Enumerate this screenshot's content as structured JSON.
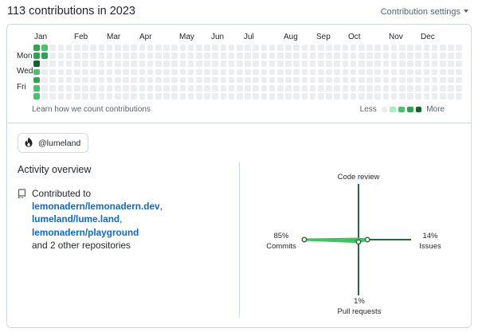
{
  "header": {
    "title": "113 contributions in 2023",
    "settings_label": "Contribution settings"
  },
  "calendar": {
    "months": [
      "Jan",
      "Feb",
      "Mar",
      "Apr",
      "May",
      "Jun",
      "Jul",
      "Aug",
      "Sep",
      "Oct",
      "Nov",
      "Dec"
    ],
    "day_labels": [
      "Mon",
      "Wed",
      "Fri"
    ],
    "weeks": 53,
    "active_cells": [
      {
        "week": 0,
        "day": 0,
        "level": 3
      },
      {
        "week": 0,
        "day": 1,
        "level": 3
      },
      {
        "week": 0,
        "day": 2,
        "level": 4
      },
      {
        "week": 0,
        "day": 3,
        "level": 2
      },
      {
        "week": 0,
        "day": 4,
        "level": 3
      },
      {
        "week": 0,
        "day": 5,
        "level": 2
      },
      {
        "week": 0,
        "day": 6,
        "level": 2
      },
      {
        "week": 1,
        "day": 0,
        "level": 2
      },
      {
        "week": 1,
        "day": 1,
        "level": 3
      }
    ],
    "footer_link": "Learn how we count contributions",
    "legend_less": "Less",
    "legend_more": "More",
    "colors": [
      "#ebedf0",
      "#aceebb",
      "#4ac26b",
      "#2da44e",
      "#116329"
    ]
  },
  "organization": {
    "name": "@lumeland",
    "icon": "lume-fire-icon"
  },
  "activity": {
    "title": "Activity overview",
    "contributed_prefix": "Contributed to",
    "repos": [
      "lemonadern/lemonadern.dev",
      "lumeland/lume.land",
      "lemonadern/playground"
    ],
    "suffix": "and 2 other repositories",
    "repo_icon": "repo-icon"
  },
  "radar": {
    "code_review": {
      "label": "Code review",
      "percent": ""
    },
    "commits": {
      "label": "Commits",
      "percent": "85%",
      "value": 85
    },
    "issues": {
      "label": "Issues",
      "percent": "14%",
      "value": 14
    },
    "pull_requests": {
      "label": "Pull requests",
      "percent": "1%",
      "value": 1
    },
    "axis_color": "#216e39",
    "fill_color": "#40c463"
  }
}
